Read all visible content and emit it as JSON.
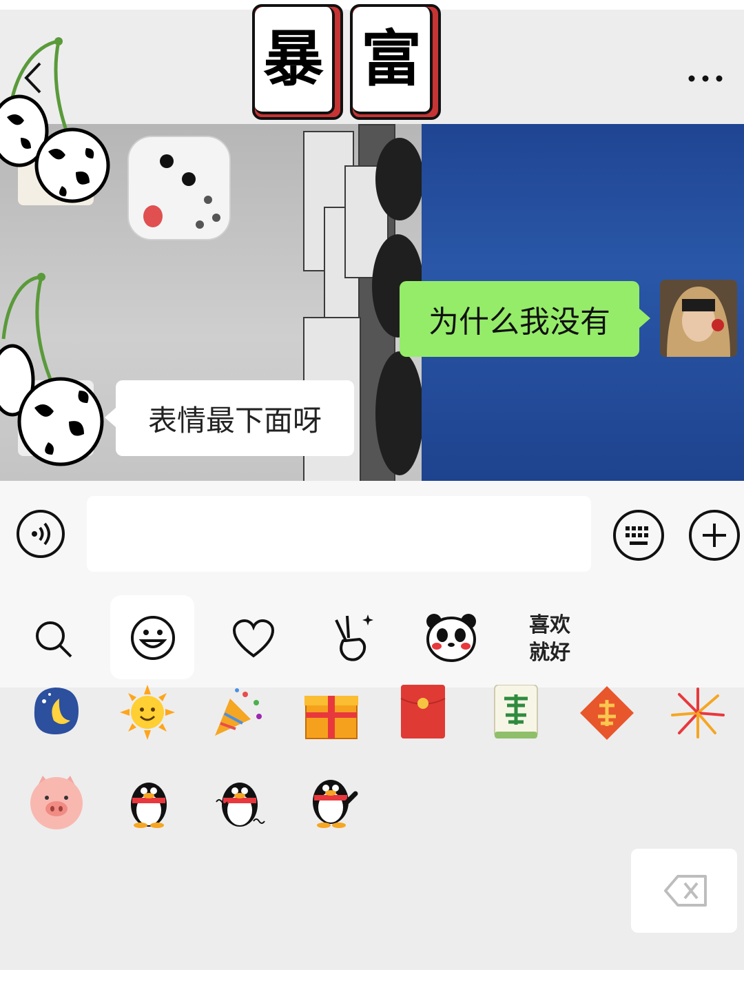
{
  "header": {
    "sticker_tiles": [
      "暴",
      "富"
    ]
  },
  "chat": {
    "messages": [
      {
        "side": "right",
        "text": "为什么我没有"
      },
      {
        "side": "left",
        "text": "表情最下面呀"
      }
    ],
    "colors": {
      "sent_bubble": "#95ec69",
      "received_bubble": "#ffffff",
      "bg_right": "#2a57a8"
    }
  },
  "input_bar": {
    "voice_icon": "voice-icon",
    "keyboard_icon": "keyboard-icon",
    "plus_icon": "plus-icon"
  },
  "emoji_tabs": {
    "items": [
      "search-icon",
      "smiley-icon",
      "heart-icon",
      "victory-hand-icon",
      "panda-icon"
    ],
    "text_tab": "喜欢\n就好"
  },
  "emoji_grid": {
    "row1": [
      "moon-icon",
      "sun-icon",
      "party-popper-icon",
      "gift-icon",
      "red-envelope-icon",
      "fa-tile-icon",
      "fu-icon",
      "fireworks-icon"
    ],
    "row2": [
      "pig-icon",
      "penguin-icon",
      "penguin-dance-icon",
      "penguin-wave-icon"
    ],
    "delete_icon": "backspace-icon"
  }
}
